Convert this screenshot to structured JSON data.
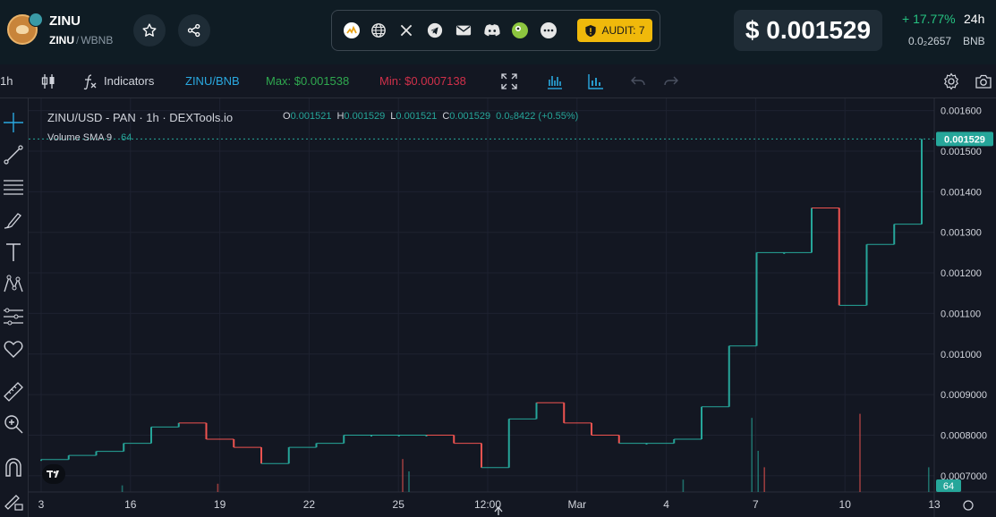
{
  "header": {
    "token_name": "ZINU",
    "pair_base": "ZINU",
    "pair_sep": "/",
    "pair_quote": "WBNB",
    "favorite_icon": "star-icon",
    "share_icon": "share-icon",
    "socials": [
      "coinmarketcap-icon",
      "globe-icon",
      "x-icon",
      "telegram-icon",
      "mail-icon",
      "discord-icon",
      "coingecko-icon",
      "more-icon"
    ],
    "audit_label": "AUDIT: 7",
    "price_usd": "$ 0.001529",
    "change_24h": "+ 17.77%",
    "change_period": "24h",
    "price_bnb": "0.0₂2657",
    "price_bnb_unit": "BNB",
    "positive_color": "#26c281"
  },
  "toolbar": {
    "interval": "1h",
    "indicators_label": "Indicators",
    "pair_label": "ZINU/BNB",
    "max_label": "Max: $0.001538",
    "min_label": "Min: $0.0007138",
    "max_color": "#2fa84f",
    "min_color": "#d0304a",
    "pair_color": "#2aa9e0"
  },
  "chart": {
    "legend_title": "ZINU/USD - PAN · 1h · DEXTools.io",
    "ohlc": [
      {
        "k": "O",
        "v": "0.001521"
      },
      {
        "k": "H",
        "v": "0.001529"
      },
      {
        "k": "L",
        "v": "0.001521"
      },
      {
        "k": "C",
        "v": "0.001529"
      }
    ],
    "ohlc_change": "0.0₅8422 (+0.55%)",
    "volume_label": "Volume SMA 9",
    "volume_value": "64",
    "last_price_label": "0.001529",
    "volume_badge": "64",
    "up_color": "#26a69a",
    "down_color": "#ef5350"
  },
  "chart_data": {
    "type": "line",
    "title": "ZINU/USD - PAN · 1h · DEXTools.io",
    "xlabel": "",
    "ylabel": "",
    "x_tick_labels": [
      "3",
      "16",
      "19",
      "22",
      "25",
      "12:00",
      "Mar",
      "4",
      "7",
      "10",
      "13"
    ],
    "y_tick_labels": [
      "0.0007000",
      "0.0008000",
      "0.0009000",
      "0.001000",
      "0.001100",
      "0.001200",
      "0.001300",
      "0.001400",
      "0.001500",
      "0.001600"
    ],
    "ylim": [
      0.00066,
      0.00163
    ],
    "grid": true,
    "series": [
      {
        "name": "ZINU/USD",
        "x": [
          "3",
          "",
          "",
          "",
          "",
          "16",
          "",
          "",
          "19",
          "",
          "",
          "22",
          "",
          "",
          "25",
          "",
          "",
          "12:00",
          "",
          "",
          "Mar",
          "",
          "",
          "4",
          "",
          "",
          "7",
          "",
          "",
          "10",
          "",
          "",
          "13"
        ],
        "values": [
          0.00074,
          0.00075,
          0.00076,
          0.00078,
          0.00082,
          0.00083,
          0.00079,
          0.00077,
          0.00073,
          0.00077,
          0.00078,
          0.0008,
          0.0008,
          0.0008,
          0.0008,
          0.00078,
          0.00072,
          0.00084,
          0.00088,
          0.00083,
          0.0008,
          0.00078,
          0.00078,
          0.00079,
          0.00087,
          0.00102,
          0.00125,
          0.00125,
          0.00136,
          0.00112,
          0.00127,
          0.00132,
          0.00153
        ]
      }
    ],
    "volume_points": [
      {
        "x": "16",
        "v": 8,
        "dir": "up"
      },
      {
        "x": "19",
        "v": 10,
        "dir": "down"
      },
      {
        "x": "25",
        "v": 40,
        "dir": "down"
      },
      {
        "x": "25",
        "v": 25,
        "dir": "up"
      },
      {
        "x": "4",
        "v": 15,
        "dir": "up"
      },
      {
        "x": "7",
        "v": 90,
        "dir": "up"
      },
      {
        "x": "7",
        "v": 50,
        "dir": "up"
      },
      {
        "x": "7",
        "v": 30,
        "dir": "down"
      },
      {
        "x": "10",
        "v": 95,
        "dir": "down"
      },
      {
        "x": "13",
        "v": 30,
        "dir": "up"
      }
    ]
  }
}
